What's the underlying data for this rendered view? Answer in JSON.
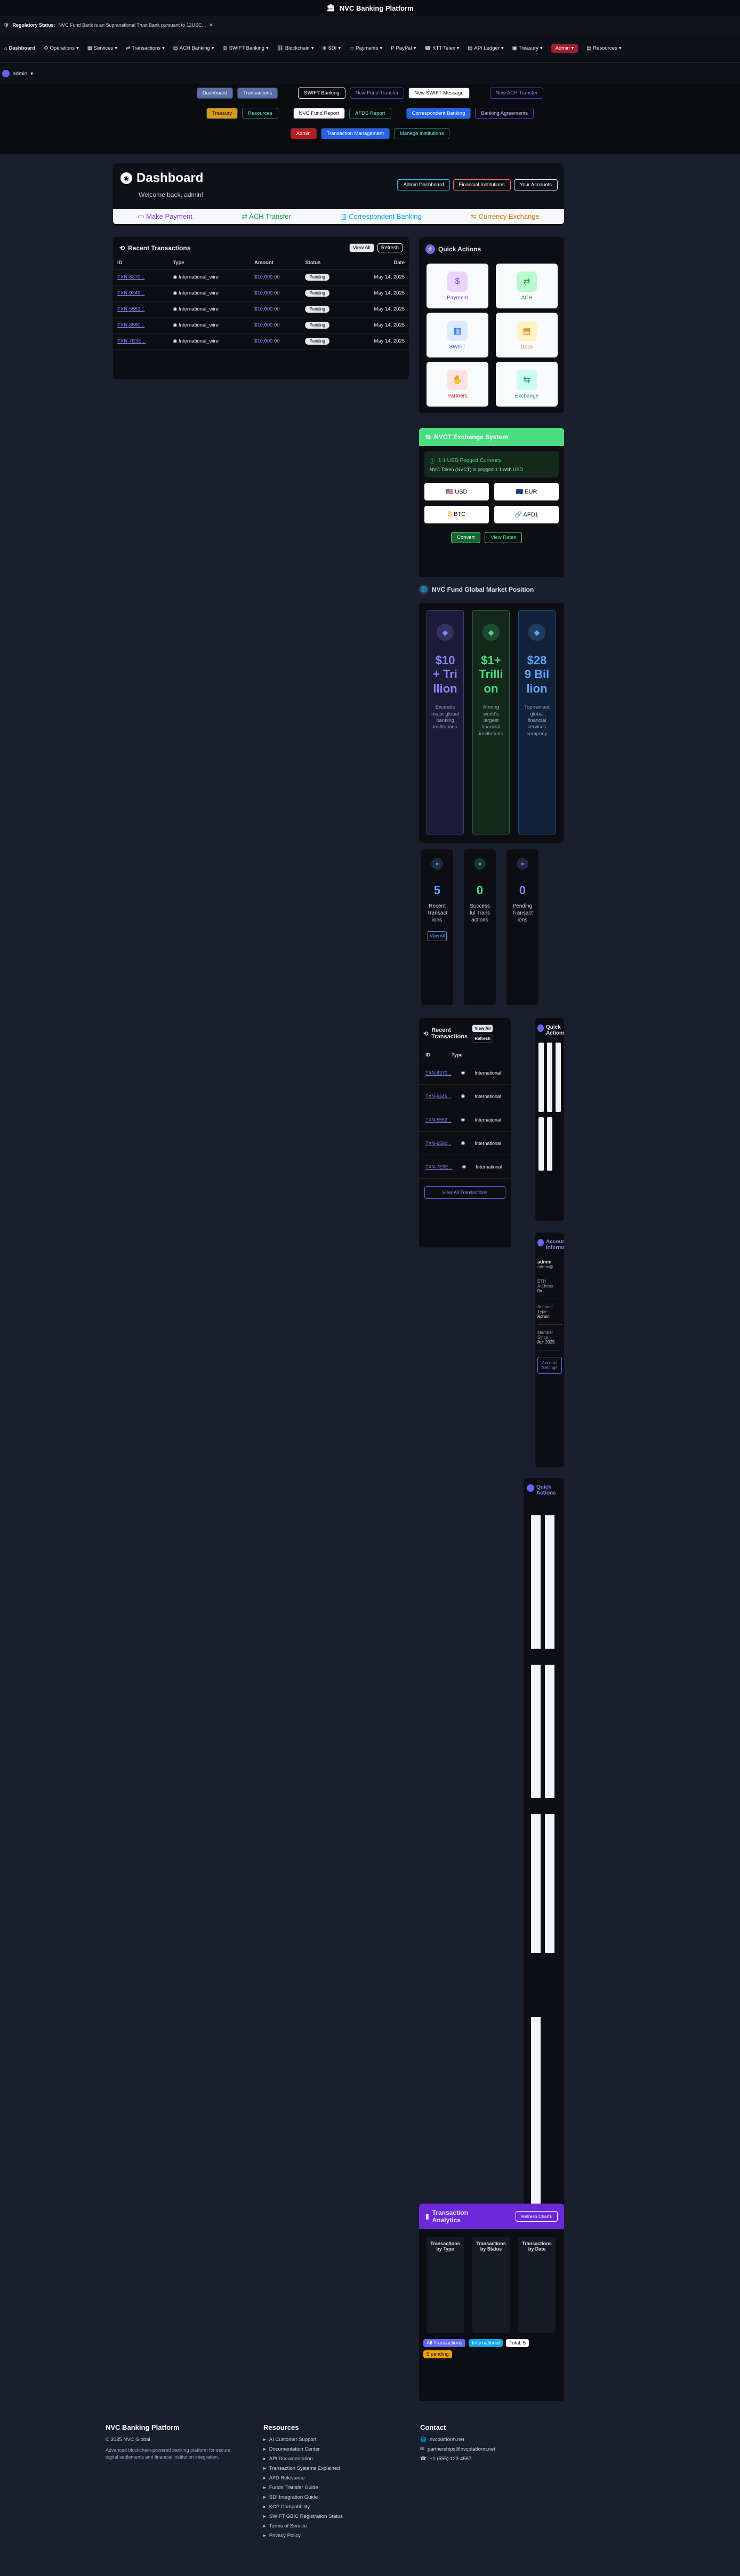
{
  "header": {
    "title": "NVC Banking Platform"
  },
  "regulatory": {
    "label": "Regulatory Status:",
    "text": "NVC Fund Bank is an Supranational Trust Bank pursuant to 12USC..."
  },
  "nav": [
    "Operations",
    "Services",
    "Transactions",
    "ACH Banking",
    "SWIFT Banking",
    "Blockchain",
    "SDI",
    "Payments",
    "PayPal",
    "KTT Telex",
    "API Ledger",
    "Treasury",
    "Admin",
    "Resources"
  ],
  "user": {
    "name": "admin"
  },
  "subnav": {
    "row1": [
      "Dashboard",
      "Transactions",
      "SWIFT Banking",
      "New Fund Transfer",
      "New SWIFT Message",
      "New ACH Transfer"
    ],
    "row2": [
      "Treasury",
      "Resources",
      "NVC Fund Report",
      "AFDS Report",
      "Correspondent Banking",
      "Banking Agreements"
    ],
    "row3": [
      "Admin",
      "Transaction Management",
      "Manage Institutions"
    ]
  },
  "dashboard": {
    "title": "Dashboard",
    "welcome": "Welcome back, admin!",
    "buttons": [
      "Admin Dashboard",
      "Financial Institutions",
      "Your Accounts"
    ],
    "tabs": [
      "Make Payment",
      "ACH Transfer",
      "Correspondent Banking",
      "Currency Exchange"
    ]
  },
  "recent": {
    "title": "Recent Transactions",
    "view_all": "View All",
    "refresh": "Refresh",
    "headers": [
      "ID",
      "Type",
      "Amount",
      "Status",
      "Date"
    ],
    "rows": [
      {
        "id": "TXN-8370...",
        "type": "International_wire",
        "amount": "$10,000.00",
        "status": "Pending",
        "date": "May 14, 2025"
      },
      {
        "id": "TXN-9349...",
        "type": "International_wire",
        "amount": "$10,000.00",
        "status": "Pending",
        "date": "May 14, 2025"
      },
      {
        "id": "TXN-5553...",
        "type": "International_wire",
        "amount": "$10,000.00",
        "status": "Pending",
        "date": "May 14, 2025"
      },
      {
        "id": "TXN-6580...",
        "type": "International_wire",
        "amount": "$10,000.00",
        "status": "Pending",
        "date": "May 14, 2025"
      },
      {
        "id": "TXN-7E3E...",
        "type": "International_wire",
        "amount": "$10,000.00",
        "status": "Pending",
        "date": "May 14, 2025"
      }
    ]
  },
  "quick": {
    "title": "Quick Actions",
    "items": [
      {
        "label": "Payment",
        "color": "#e9d5ff",
        "fg": "#7c3aed",
        "glyph": "$"
      },
      {
        "label": "ACH",
        "color": "#bbf7d0",
        "fg": "#16a34a",
        "glyph": "⇄"
      },
      {
        "label": "SWIFT",
        "color": "#dbeafe",
        "fg": "#2563eb",
        "glyph": "▥"
      },
      {
        "label": "Docs",
        "color": "#fef3c7",
        "fg": "#d97706",
        "glyph": "▤"
      },
      {
        "label": "Partners",
        "color": "#fee2e2",
        "fg": "#dc2626",
        "glyph": "✋"
      },
      {
        "label": "Exchange",
        "color": "#ccfbf1",
        "fg": "#0d9488",
        "glyph": "⇆"
      }
    ]
  },
  "nvct": {
    "title": "NVCT Exchange System",
    "notice": "1:1 USD Pegged Currency",
    "notice_sub": "NVC Token (NVCT) is pegged 1:1 with USD",
    "pairs": [
      "USD",
      "EUR",
      "BTC",
      "AFD1"
    ],
    "convert": "Convert",
    "view_rates": "View Rates"
  },
  "market": {
    "title": "NVC Fund Global Market Position",
    "cols": [
      {
        "value": "$10+ Trillion",
        "desc": "Exceeds major global banking institutions",
        "color": "#818cf8",
        "bg": "#1e1b3a"
      },
      {
        "value": "$1+ Trillion",
        "desc": "Among world's largest financial institutions",
        "color": "#4ade80",
        "bg": "#14291c"
      },
      {
        "value": "$289 Billion",
        "desc": "Top-ranked global financial services company",
        "color": "#60a5fa",
        "bg": "#10233a"
      }
    ]
  },
  "stats": [
    {
      "value": "5",
      "label": "Recent Transactions",
      "color": "#60a5fa",
      "extra": "View All"
    },
    {
      "value": "0",
      "label": "Successful Transactions",
      "color": "#4ade80",
      "extra": ""
    },
    {
      "value": "0",
      "label": "Pending Transactions",
      "color": "#818cf8",
      "extra": ""
    }
  ],
  "mini_recent": {
    "title": "Recent Transactions",
    "view_all": "View All",
    "refresh": "Refresh",
    "headers": [
      "ID",
      "Type"
    ],
    "rows": [
      "TXN-8370...",
      "TXN-9349...",
      "TXN-5553...",
      "TXN-6580...",
      "TXN-7E3E..."
    ],
    "type": "International",
    "view_all_button": "View All Transactions"
  },
  "mini_quick": {
    "title": "Quick Actions"
  },
  "account": {
    "title": "Account Information",
    "name": "admin",
    "email": "admin@...",
    "rows": [
      {
        "label": "ETH Address",
        "value": "0x..."
      },
      {
        "label": "Account Type",
        "value": "Admin"
      },
      {
        "label": "Member Since",
        "value": "Apr 2025"
      }
    ],
    "settings": "Account Settings"
  },
  "analytics": {
    "title": "Transaction Analytics",
    "refresh": "Refresh Charts",
    "charts": [
      "Transactions by Type",
      "Transactions by Status",
      "Transactions by Date"
    ],
    "tags": [
      "All Transactions",
      "International",
      "Total: 5",
      "5 pending"
    ]
  },
  "footer": {
    "brand": "NVC Banking Platform",
    "copyright": "© 2025 NVC Global",
    "tagline": "Advanced blockchain-powered banking platform for secure digital settlements and financial institution integration.",
    "resources_title": "Resources",
    "resources": [
      "AI Customer Support",
      "Documentation Center",
      "API Documentation",
      "Transaction Systems Explained",
      "AFD Relevance",
      "Funds Transfer Guide",
      "SDI Integration Guide",
      "KCP Compatibility",
      "SWIFT GBIC Registration Status",
      "Terms of Service",
      "Privacy Policy"
    ],
    "contact_title": "Contact",
    "contact": [
      "nvcplatform.net",
      "partnerships@nvcplatform.net",
      "+1 (555) 123-4567"
    ]
  }
}
